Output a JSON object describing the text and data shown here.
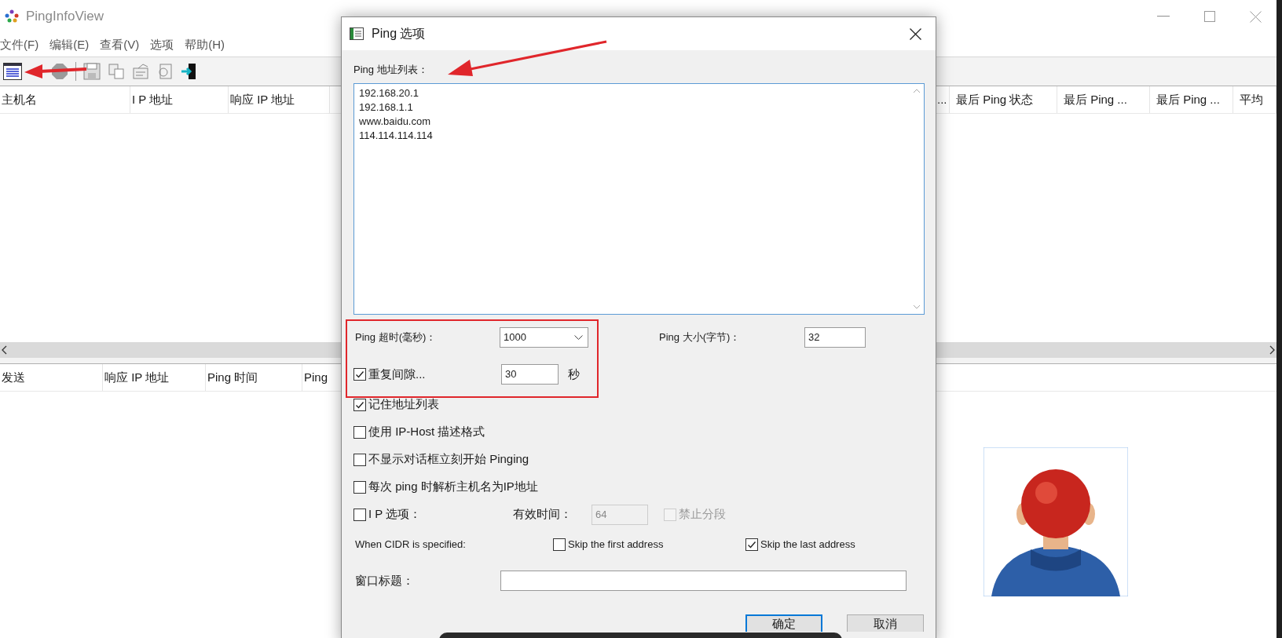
{
  "main_window": {
    "title": "PingInfoView",
    "menu": [
      "文件(F)",
      "编辑(E)",
      "查看(V)",
      "选项",
      "帮助(H)"
    ],
    "columns_left": [
      "主机名",
      "I P 地址",
      "响应 IP 地址"
    ],
    "columns_right": [
      "...",
      "最后 Ping 状态",
      "最后 Ping ...",
      "最后 Ping ...",
      "平均"
    ],
    "lower_columns": [
      "发送",
      "响应 IP 地址",
      "Ping 时间",
      "Ping"
    ]
  },
  "dialog": {
    "title": "Ping 选项",
    "address_list_label": "Ping 地址列表：",
    "addresses": [
      "192.168.20.1",
      "192.168.1.1",
      "www.baidu.com",
      "114.114.114.114"
    ],
    "timeout": {
      "label": "Ping 超时(毫秒)：",
      "value": "1000"
    },
    "packet_size": {
      "label": "Ping 大小(字节)：",
      "value": "32"
    },
    "repeat": {
      "label": "重复间隙...",
      "checked": true,
      "value": "30",
      "unit": "秒"
    },
    "options": [
      {
        "label": "记住地址列表",
        "checked": true
      },
      {
        "label": "使用 IP-Host 描述格式",
        "checked": false
      },
      {
        "label": "不显示对话框立刻开始 Pinging",
        "checked": false
      },
      {
        "label": "每次 ping 时解析主机名为IP地址",
        "checked": false
      }
    ],
    "ip_options": {
      "label": "I P 选项：",
      "checked": false,
      "ttl_label": "有效时间：",
      "ttl_value": "64",
      "dont_fragment": {
        "label": "禁止分段",
        "checked": false,
        "disabled": true
      }
    },
    "cidr": {
      "label": "When CIDR is specified:",
      "options": [
        {
          "label": "Skip the first address",
          "checked": false
        },
        {
          "label": "Skip the last address",
          "checked": true
        }
      ]
    },
    "window_title": {
      "label": "窗口标题："
    },
    "buttons": [
      {
        "label": "确定",
        "default": true
      },
      {
        "label": "取消",
        "default": false
      }
    ]
  }
}
